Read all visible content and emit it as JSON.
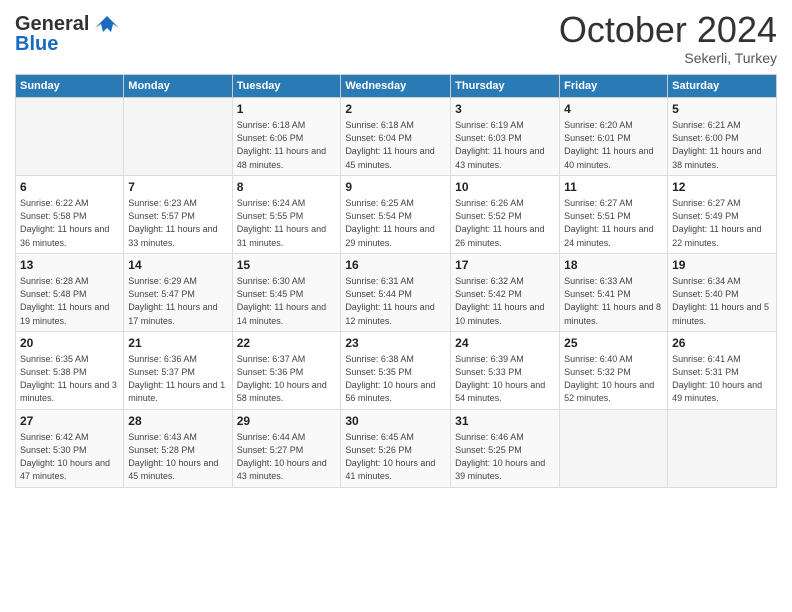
{
  "logo": {
    "general": "General",
    "blue": "Blue"
  },
  "header": {
    "month": "October 2024",
    "location": "Sekerli, Turkey"
  },
  "days_of_week": [
    "Sunday",
    "Monday",
    "Tuesday",
    "Wednesday",
    "Thursday",
    "Friday",
    "Saturday"
  ],
  "weeks": [
    [
      {
        "day": "",
        "sunrise": "",
        "sunset": "",
        "daylight": ""
      },
      {
        "day": "",
        "sunrise": "",
        "sunset": "",
        "daylight": ""
      },
      {
        "day": "1",
        "sunrise": "Sunrise: 6:18 AM",
        "sunset": "Sunset: 6:06 PM",
        "daylight": "Daylight: 11 hours and 48 minutes."
      },
      {
        "day": "2",
        "sunrise": "Sunrise: 6:18 AM",
        "sunset": "Sunset: 6:04 PM",
        "daylight": "Daylight: 11 hours and 45 minutes."
      },
      {
        "day": "3",
        "sunrise": "Sunrise: 6:19 AM",
        "sunset": "Sunset: 6:03 PM",
        "daylight": "Daylight: 11 hours and 43 minutes."
      },
      {
        "day": "4",
        "sunrise": "Sunrise: 6:20 AM",
        "sunset": "Sunset: 6:01 PM",
        "daylight": "Daylight: 11 hours and 40 minutes."
      },
      {
        "day": "5",
        "sunrise": "Sunrise: 6:21 AM",
        "sunset": "Sunset: 6:00 PM",
        "daylight": "Daylight: 11 hours and 38 minutes."
      }
    ],
    [
      {
        "day": "6",
        "sunrise": "Sunrise: 6:22 AM",
        "sunset": "Sunset: 5:58 PM",
        "daylight": "Daylight: 11 hours and 36 minutes."
      },
      {
        "day": "7",
        "sunrise": "Sunrise: 6:23 AM",
        "sunset": "Sunset: 5:57 PM",
        "daylight": "Daylight: 11 hours and 33 minutes."
      },
      {
        "day": "8",
        "sunrise": "Sunrise: 6:24 AM",
        "sunset": "Sunset: 5:55 PM",
        "daylight": "Daylight: 11 hours and 31 minutes."
      },
      {
        "day": "9",
        "sunrise": "Sunrise: 6:25 AM",
        "sunset": "Sunset: 5:54 PM",
        "daylight": "Daylight: 11 hours and 29 minutes."
      },
      {
        "day": "10",
        "sunrise": "Sunrise: 6:26 AM",
        "sunset": "Sunset: 5:52 PM",
        "daylight": "Daylight: 11 hours and 26 minutes."
      },
      {
        "day": "11",
        "sunrise": "Sunrise: 6:27 AM",
        "sunset": "Sunset: 5:51 PM",
        "daylight": "Daylight: 11 hours and 24 minutes."
      },
      {
        "day": "12",
        "sunrise": "Sunrise: 6:27 AM",
        "sunset": "Sunset: 5:49 PM",
        "daylight": "Daylight: 11 hours and 22 minutes."
      }
    ],
    [
      {
        "day": "13",
        "sunrise": "Sunrise: 6:28 AM",
        "sunset": "Sunset: 5:48 PM",
        "daylight": "Daylight: 11 hours and 19 minutes."
      },
      {
        "day": "14",
        "sunrise": "Sunrise: 6:29 AM",
        "sunset": "Sunset: 5:47 PM",
        "daylight": "Daylight: 11 hours and 17 minutes."
      },
      {
        "day": "15",
        "sunrise": "Sunrise: 6:30 AM",
        "sunset": "Sunset: 5:45 PM",
        "daylight": "Daylight: 11 hours and 14 minutes."
      },
      {
        "day": "16",
        "sunrise": "Sunrise: 6:31 AM",
        "sunset": "Sunset: 5:44 PM",
        "daylight": "Daylight: 11 hours and 12 minutes."
      },
      {
        "day": "17",
        "sunrise": "Sunrise: 6:32 AM",
        "sunset": "Sunset: 5:42 PM",
        "daylight": "Daylight: 11 hours and 10 minutes."
      },
      {
        "day": "18",
        "sunrise": "Sunrise: 6:33 AM",
        "sunset": "Sunset: 5:41 PM",
        "daylight": "Daylight: 11 hours and 8 minutes."
      },
      {
        "day": "19",
        "sunrise": "Sunrise: 6:34 AM",
        "sunset": "Sunset: 5:40 PM",
        "daylight": "Daylight: 11 hours and 5 minutes."
      }
    ],
    [
      {
        "day": "20",
        "sunrise": "Sunrise: 6:35 AM",
        "sunset": "Sunset: 5:38 PM",
        "daylight": "Daylight: 11 hours and 3 minutes."
      },
      {
        "day": "21",
        "sunrise": "Sunrise: 6:36 AM",
        "sunset": "Sunset: 5:37 PM",
        "daylight": "Daylight: 11 hours and 1 minute."
      },
      {
        "day": "22",
        "sunrise": "Sunrise: 6:37 AM",
        "sunset": "Sunset: 5:36 PM",
        "daylight": "Daylight: 10 hours and 58 minutes."
      },
      {
        "day": "23",
        "sunrise": "Sunrise: 6:38 AM",
        "sunset": "Sunset: 5:35 PM",
        "daylight": "Daylight: 10 hours and 56 minutes."
      },
      {
        "day": "24",
        "sunrise": "Sunrise: 6:39 AM",
        "sunset": "Sunset: 5:33 PM",
        "daylight": "Daylight: 10 hours and 54 minutes."
      },
      {
        "day": "25",
        "sunrise": "Sunrise: 6:40 AM",
        "sunset": "Sunset: 5:32 PM",
        "daylight": "Daylight: 10 hours and 52 minutes."
      },
      {
        "day": "26",
        "sunrise": "Sunrise: 6:41 AM",
        "sunset": "Sunset: 5:31 PM",
        "daylight": "Daylight: 10 hours and 49 minutes."
      }
    ],
    [
      {
        "day": "27",
        "sunrise": "Sunrise: 6:42 AM",
        "sunset": "Sunset: 5:30 PM",
        "daylight": "Daylight: 10 hours and 47 minutes."
      },
      {
        "day": "28",
        "sunrise": "Sunrise: 6:43 AM",
        "sunset": "Sunset: 5:28 PM",
        "daylight": "Daylight: 10 hours and 45 minutes."
      },
      {
        "day": "29",
        "sunrise": "Sunrise: 6:44 AM",
        "sunset": "Sunset: 5:27 PM",
        "daylight": "Daylight: 10 hours and 43 minutes."
      },
      {
        "day": "30",
        "sunrise": "Sunrise: 6:45 AM",
        "sunset": "Sunset: 5:26 PM",
        "daylight": "Daylight: 10 hours and 41 minutes."
      },
      {
        "day": "31",
        "sunrise": "Sunrise: 6:46 AM",
        "sunset": "Sunset: 5:25 PM",
        "daylight": "Daylight: 10 hours and 39 minutes."
      },
      {
        "day": "",
        "sunrise": "",
        "sunset": "",
        "daylight": ""
      },
      {
        "day": "",
        "sunrise": "",
        "sunset": "",
        "daylight": ""
      }
    ]
  ]
}
